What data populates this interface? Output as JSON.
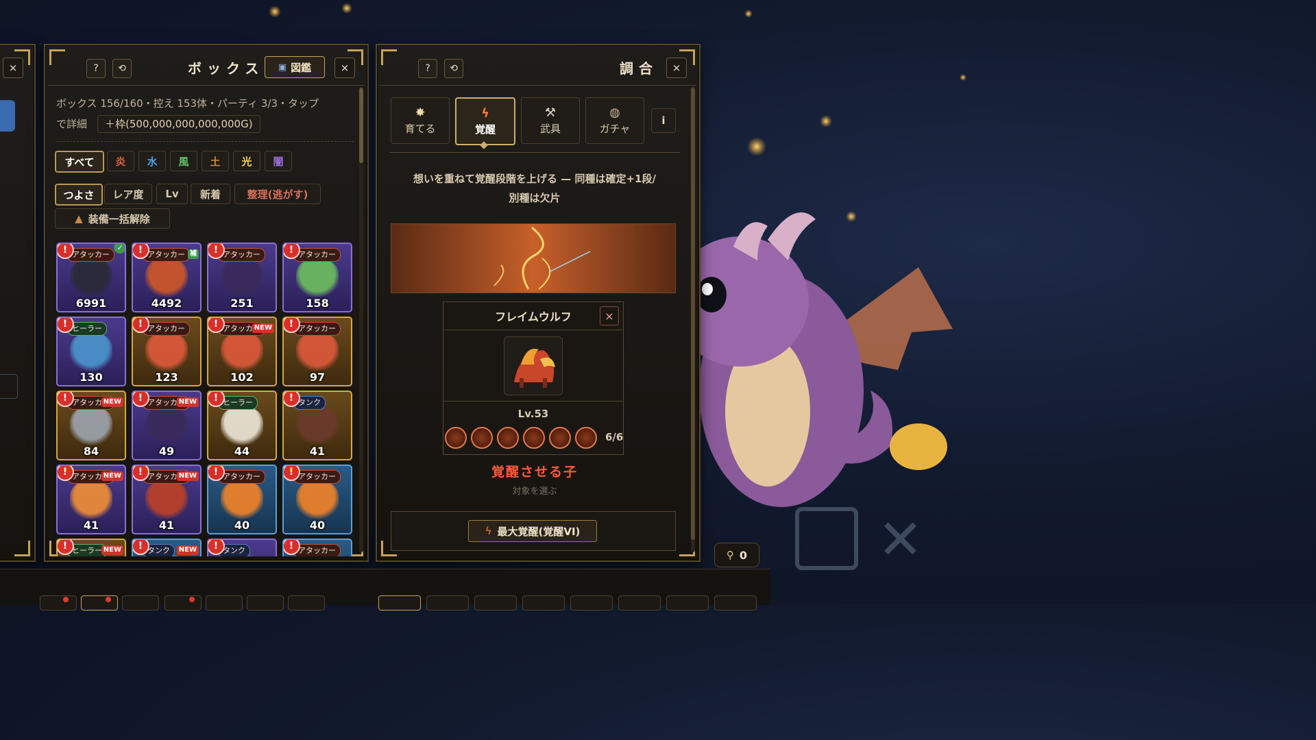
{
  "left_stub": {
    "close": "×"
  },
  "box_panel": {
    "help": "?",
    "refresh": "⟲",
    "title": "ボックス",
    "dex_icon": "book-icon",
    "dex_label": "図鑑",
    "close": "×",
    "info_line1": "ボックス 156/160・控え 153体・パーティ 3/3・タップ",
    "info_line2": "で詳細",
    "expand_label": "＋枠(500,000,000,000,000G)",
    "element_filters": [
      {
        "label": "すべて",
        "color": "#ffffff"
      },
      {
        "label": "炎",
        "color": "#e0603c"
      },
      {
        "label": "水",
        "color": "#4aa0e8"
      },
      {
        "label": "風",
        "color": "#5ec06a"
      },
      {
        "label": "土",
        "color": "#c88a3c"
      },
      {
        "label": "光",
        "color": "#f0d050"
      },
      {
        "label": "闇",
        "color": "#a070e0"
      }
    ],
    "sort_options": [
      {
        "label": "つよさ"
      },
      {
        "label": "レア度"
      },
      {
        "label": "Lv"
      },
      {
        "label": "新着"
      },
      {
        "label": "整理(逃がす)"
      }
    ],
    "unequip_label": "装備一括解除",
    "monsters": [
      {
        "role": "アタッカー",
        "value": "6991",
        "tier": "purple",
        "check": true,
        "new": false,
        "art": "#2a2a3a"
      },
      {
        "role": "アタッカー",
        "value": "4492",
        "tier": "purple",
        "check": false,
        "new": false,
        "sub": "補",
        "art": "#c8562a"
      },
      {
        "role": "アタッカー",
        "value": "251",
        "tier": "purple",
        "check": false,
        "new": false,
        "art": "#3a2a5a"
      },
      {
        "role": "アタッカー",
        "value": "158",
        "tier": "purple",
        "check": false,
        "new": false,
        "art": "#6ab860"
      },
      {
        "role": "ヒーラー",
        "value": "130",
        "tier": "purple",
        "check": false,
        "new": false,
        "art": "#4a90c8"
      },
      {
        "role": "アタッカー",
        "value": "123",
        "tier": "gold",
        "check": false,
        "new": false,
        "art": "#d8583a"
      },
      {
        "role": "アタッカー",
        "value": "102",
        "tier": "gold",
        "check": false,
        "new": true,
        "art": "#d8583a"
      },
      {
        "role": "アタッカー",
        "value": "97",
        "tier": "gold",
        "check": false,
        "new": false,
        "art": "#d8583a"
      },
      {
        "role": "アタッカー",
        "value": "84",
        "tier": "gold",
        "check": false,
        "new": true,
        "art": "#9aa0a8"
      },
      {
        "role": "アタッカー",
        "value": "49",
        "tier": "purple",
        "check": false,
        "new": true,
        "art": "#3a2a5a"
      },
      {
        "role": "ヒーラー",
        "value": "44",
        "tier": "gold",
        "check": false,
        "new": false,
        "art": "#e8e0d0"
      },
      {
        "role": "タンク",
        "value": "41",
        "tier": "gold",
        "check": false,
        "new": false,
        "art": "#6a3a2a"
      },
      {
        "role": "アタッカー",
        "value": "41",
        "tier": "purple",
        "check": false,
        "new": true,
        "art": "#e88a3a"
      },
      {
        "role": "アタッカー",
        "value": "41",
        "tier": "purple",
        "check": false,
        "new": true,
        "art": "#b8402a"
      },
      {
        "role": "アタッカー",
        "value": "40",
        "tier": "blue",
        "check": false,
        "new": false,
        "art": "#e8802a"
      },
      {
        "role": "アタッカー",
        "value": "40",
        "tier": "blue",
        "check": false,
        "new": false,
        "art": "#e8802a"
      },
      {
        "role": "ヒーラー",
        "value": "",
        "tier": "gold",
        "check": false,
        "new": true,
        "art": "#c8a040"
      },
      {
        "role": "タンク",
        "value": "",
        "tier": "blue",
        "check": false,
        "new": true,
        "art": "#4a80c0"
      },
      {
        "role": "タンク",
        "value": "",
        "tier": "purple",
        "check": false,
        "new": false,
        "art": "#6a5aa0"
      },
      {
        "role": "アタッカー",
        "value": "",
        "tier": "blue",
        "check": false,
        "new": false,
        "art": "#4a80c0"
      }
    ]
  },
  "craft_panel": {
    "help": "?",
    "refresh": "⟲",
    "title": "調合",
    "close": "×",
    "tabs": [
      {
        "label": "育てる",
        "icon": "sparkle-icon",
        "glyph": "✸"
      },
      {
        "label": "覚醒",
        "icon": "lightning-icon",
        "glyph": "ϟ"
      },
      {
        "label": "武具",
        "icon": "tools-icon",
        "glyph": "⚒"
      },
      {
        "label": "ガチャ",
        "icon": "coin-icon",
        "glyph": "◍"
      }
    ],
    "info_button": "i",
    "description_line1": "想いを重ねて覚醒段階を上げる — 同種は確定+1段/",
    "description_line2": "別種は欠片",
    "monster_card": {
      "name": "フレイムウルフ",
      "level": "Lv.53",
      "awaken_current": 6,
      "awaken_max": 6,
      "progress_text": "6/6",
      "close": "×"
    },
    "target_label": "覚醒させる子",
    "target_hint": "対象を選ぶ",
    "max_awaken_label": "最大覚醒(覚醒VI)"
  },
  "hud": {
    "key_count": "0"
  }
}
